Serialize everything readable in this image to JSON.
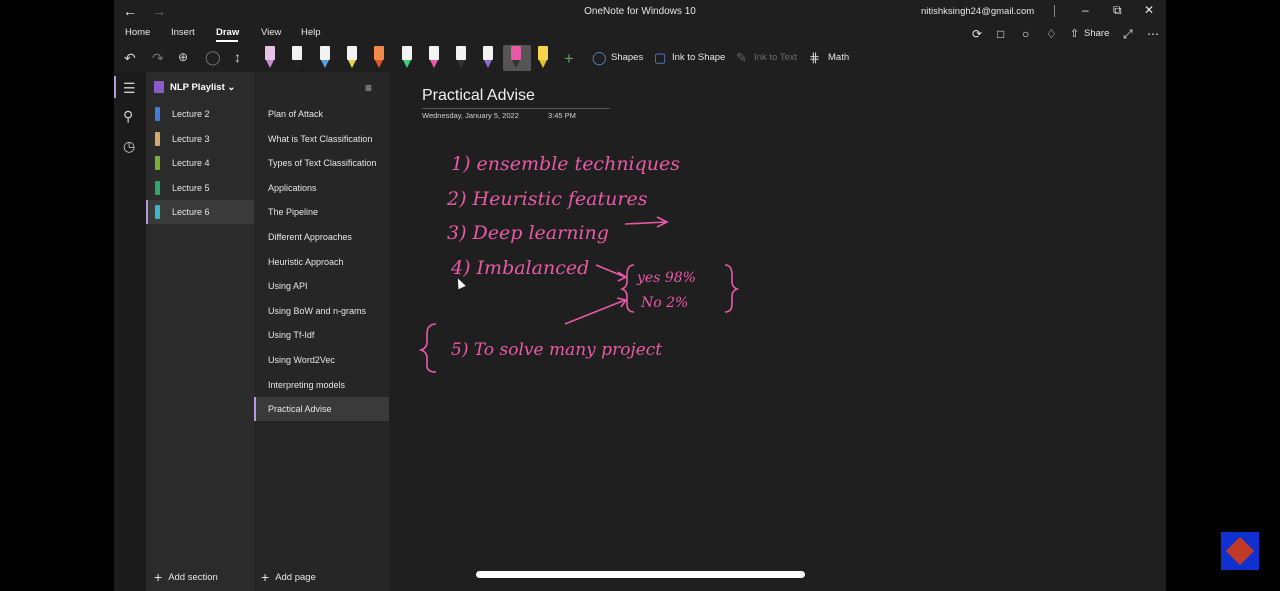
{
  "window": {
    "title": "OneNote for Windows 10",
    "account": "nitishksingh24@gmail.com",
    "back_icon": "arrow-left-icon",
    "forward_icon": "arrow-right-icon"
  },
  "ribbon": {
    "tabs": [
      "Home",
      "Insert",
      "Draw",
      "View",
      "Help"
    ],
    "active_tab": "Draw",
    "share_label": "Share"
  },
  "toolbar": {
    "pens": [
      {
        "color": "#e6c3e6",
        "tip": "#c98ad2"
      },
      {
        "color": "#f2f2f2",
        "tip": "#222222"
      },
      {
        "color": "#f2f2f2",
        "tip": "#4fa3e0"
      },
      {
        "color": "#f2f2f2",
        "tip": "#e8d24a"
      },
      {
        "color": "#f28a4a",
        "tip": "#e2562a"
      },
      {
        "color": "#f2f2f2",
        "tip": "#3ecf7a"
      },
      {
        "color": "#f2f2f2",
        "tip": "#e85aa5"
      },
      {
        "color": "#f2f2f2",
        "tip": "#333333"
      },
      {
        "color": "#f2f2f2",
        "tip": "#8a6ad2"
      },
      {
        "color": "#e85aa5",
        "tip": "#333333"
      },
      {
        "color": "#f5d64a",
        "tip": "#e0c12a"
      }
    ],
    "shapes_label": "Shapes",
    "ink_to_shape_label": "Ink to Shape",
    "ink_to_text_label": "Ink to Text",
    "math_label": "Math"
  },
  "notebook": {
    "name": "NLP Playlist",
    "sections": [
      {
        "label": "Lecture 2",
        "color": "#3f7ee0"
      },
      {
        "label": "Lecture 3",
        "color": "#d6a86a"
      },
      {
        "label": "Lecture 4",
        "color": "#7ab22e"
      },
      {
        "label": "Lecture 5",
        "color": "#2fa66a"
      },
      {
        "label": "Lecture 6",
        "color": "#3bb6c8"
      }
    ],
    "active_section": "Lecture 6",
    "add_section_label": "Add section"
  },
  "pages": {
    "items": [
      "Plan of Attack",
      "What is Text Classification",
      "Types of Text Classification",
      "Applications",
      "The Pipeline",
      "Different Approaches",
      "Heuristic Approach",
      "Using API",
      "Using BoW and n-grams",
      "Using Tf-Idf",
      "Using Word2Vec",
      "Interpreting models",
      "Practical Advise"
    ],
    "active_page": "Practical Advise",
    "add_page_label": "Add page"
  },
  "note": {
    "title": "Practical Advise",
    "date": "Wednesday, January 5, 2022",
    "time": "3:45 PM",
    "ink": {
      "line1": "1) ensemble techniques",
      "line2": "2) Heuristic features",
      "line3": "3) Deep learning",
      "line4": "4) Imbalanced",
      "brace_top": "yes 98%",
      "brace_bottom": "No 2%",
      "line5": "5) To solve many project"
    }
  }
}
